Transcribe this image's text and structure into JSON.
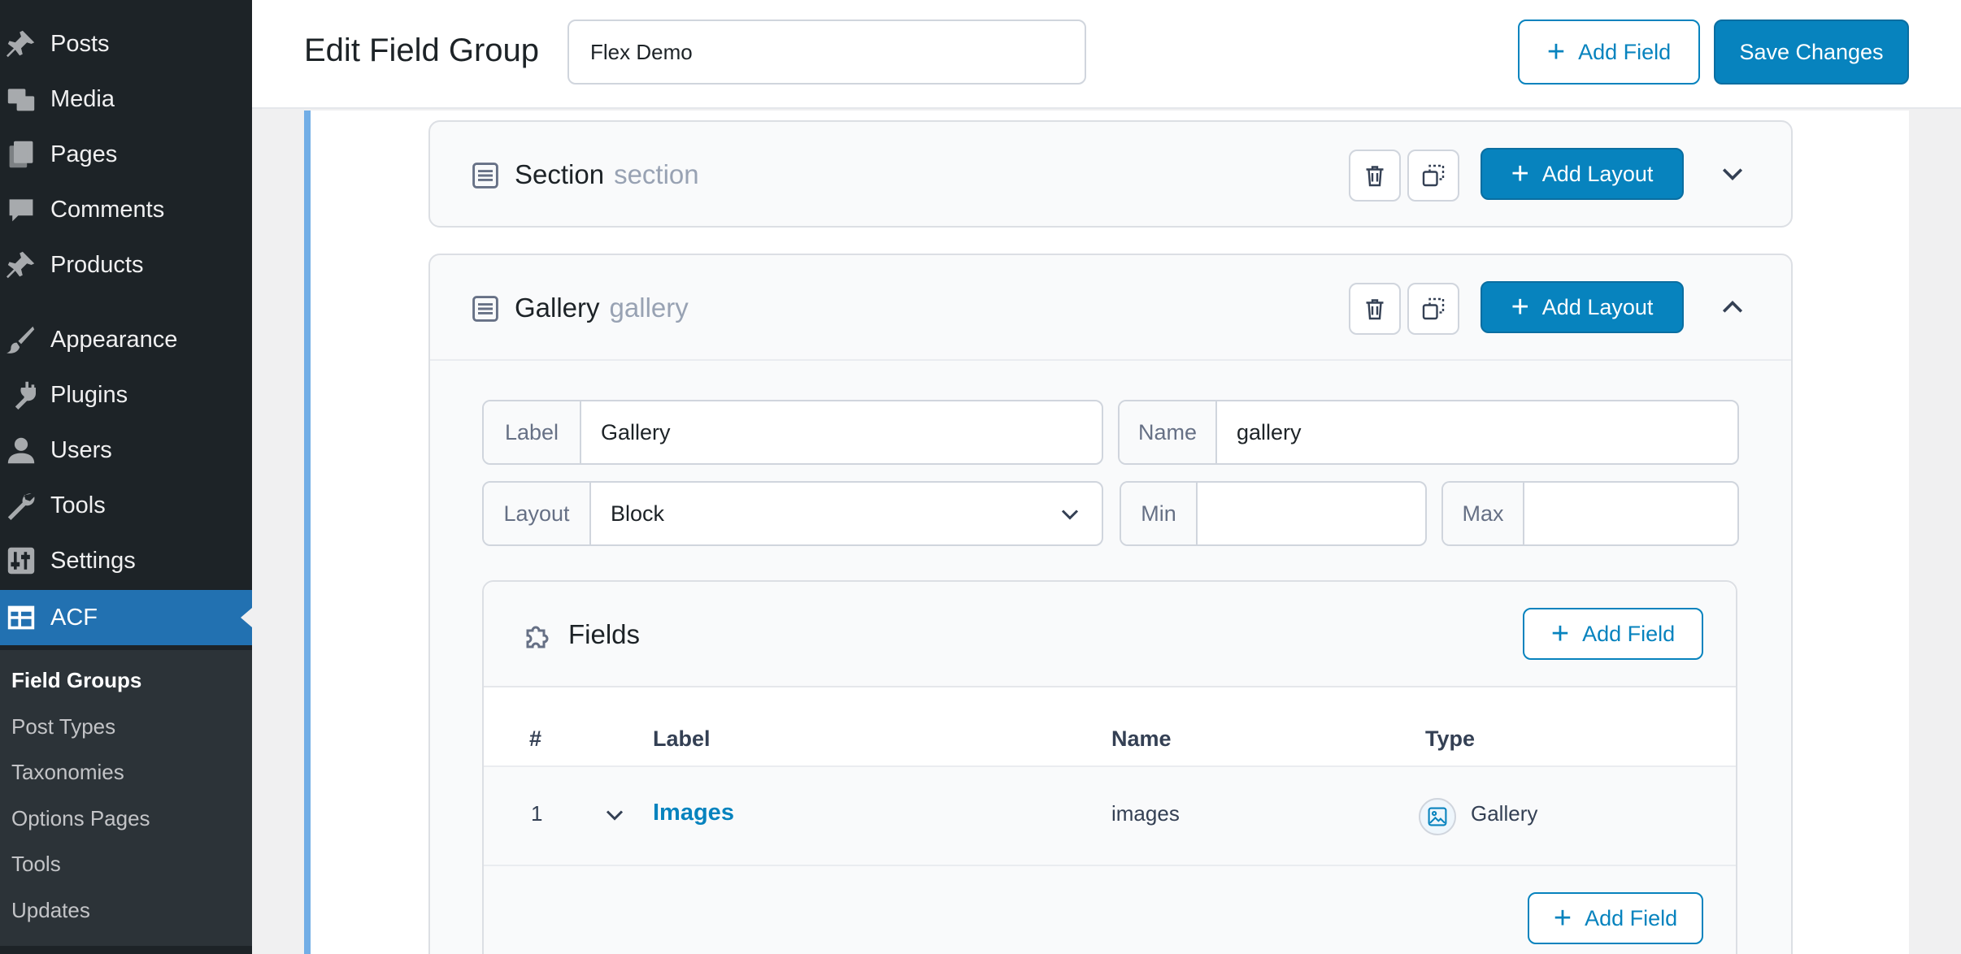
{
  "sidebar": {
    "menu": [
      {
        "label": "Posts",
        "icon": "pin-icon"
      },
      {
        "label": "Media",
        "icon": "media-icon"
      },
      {
        "label": "Pages",
        "icon": "pages-icon"
      },
      {
        "label": "Comments",
        "icon": "comment-icon"
      },
      {
        "label": "Products",
        "icon": "pin-icon"
      },
      {
        "label": "Appearance",
        "icon": "brush-icon"
      },
      {
        "label": "Plugins",
        "icon": "plug-icon"
      },
      {
        "label": "Users",
        "icon": "user-icon"
      },
      {
        "label": "Tools",
        "icon": "wrench-icon"
      },
      {
        "label": "Settings",
        "icon": "sliders-icon"
      },
      {
        "label": "ACF",
        "icon": "acf-grid-icon",
        "active": true
      }
    ],
    "submenu": [
      "Field Groups",
      "Post Types",
      "Taxonomies",
      "Options Pages",
      "Tools",
      "Updates"
    ],
    "submenu_current": "Field Groups"
  },
  "header": {
    "title": "Edit Field Group",
    "group_name_value": "Flex Demo",
    "add_field_label": "Add Field",
    "save_label": "Save Changes"
  },
  "layouts": [
    {
      "label": "Section",
      "name": "section",
      "add_layout_label": "Add Layout",
      "expanded": false
    },
    {
      "label": "Gallery",
      "name": "gallery",
      "add_layout_label": "Add Layout",
      "expanded": true
    }
  ],
  "gallery_settings": {
    "label_prefix": "Label",
    "label_value": "Gallery",
    "name_prefix": "Name",
    "name_value": "gallery",
    "layout_prefix": "Layout",
    "layout_value": "Block",
    "min_prefix": "Min",
    "min_value": "",
    "max_prefix": "Max",
    "max_value": ""
  },
  "fields_panel": {
    "title": "Fields",
    "add_field_label": "Add Field",
    "columns": [
      "#",
      "Label",
      "Name",
      "Type"
    ],
    "rows": [
      {
        "order": "1",
        "label": "Images",
        "name": "images",
        "type": "Gallery"
      }
    ],
    "bottom_add_field_label": "Add Field"
  },
  "colors": {
    "accent": "#0783be",
    "sidebar_bg": "#1d2327",
    "sidebar_active": "#2271b1"
  }
}
